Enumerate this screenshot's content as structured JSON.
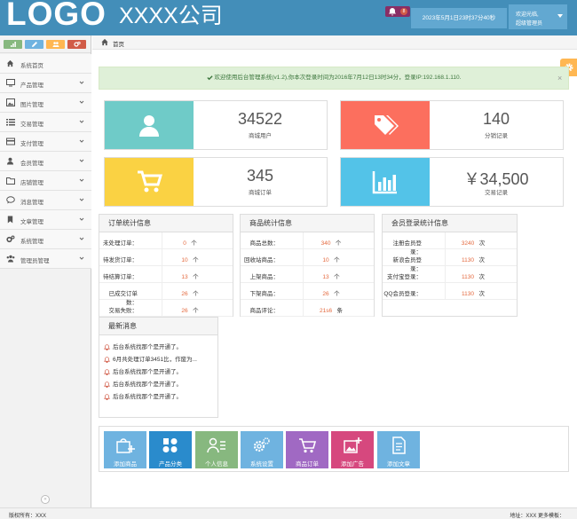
{
  "header": {
    "logo": "LOGO",
    "company": "XXXX公司",
    "notification_count": "8",
    "datetime": "2023年5月1日23时37分40秒",
    "welcome": "欢迎光临,",
    "username": "超级管理员",
    "bg_color": "#438eb9"
  },
  "sidebar": {
    "shortcuts": [
      {
        "icon": "signal-icon",
        "color": "#87b87f"
      },
      {
        "icon": "pencil-icon",
        "color": "#6fb3e0"
      },
      {
        "icon": "users-icon",
        "color": "#ffb752"
      },
      {
        "icon": "cogs-icon",
        "color": "#d15b47"
      }
    ],
    "items": [
      {
        "label": "系统首页",
        "icon": "home-icon"
      },
      {
        "label": "产品管理",
        "icon": "desktop-icon"
      },
      {
        "label": "图片管理",
        "icon": "picture-icon"
      },
      {
        "label": "交易管理",
        "icon": "list-icon"
      },
      {
        "label": "支付管理",
        "icon": "credit-card-icon"
      },
      {
        "label": "会员管理",
        "icon": "user-icon"
      },
      {
        "label": "店铺管理",
        "icon": "folder-icon"
      },
      {
        "label": "消息管理",
        "icon": "comments-icon"
      },
      {
        "label": "文章管理",
        "icon": "bookmark-icon"
      },
      {
        "label": "系统管理",
        "icon": "cogs-icon"
      },
      {
        "label": "管理员管理",
        "icon": "group-icon"
      }
    ],
    "collapse_glyph": "«"
  },
  "breadcrumb": {
    "home": "首页"
  },
  "welcome_message": "欢迎使用后台管理系统(v1.2),你本次登录时间为2016年7月12日13时34分，登录IP:192.168.1.110.",
  "welcome_close": "×",
  "stats": [
    {
      "value": "34522",
      "label": "商城用户",
      "icon": "user-icon",
      "color": "#6fcbc8"
    },
    {
      "value": "140",
      "label": "分销记录",
      "icon": "tags-icon",
      "color": "#fc6f5e"
    },
    {
      "value": "345",
      "label": "商城订单",
      "icon": "shopping-cart-icon",
      "color": "#fad243"
    },
    {
      "value": "￥34,500",
      "label": "交易记录",
      "icon": "bar-chart-icon",
      "color": "#53c3e8"
    }
  ],
  "order_panel": {
    "title": "订单统计信息",
    "unit": "个",
    "rows": [
      {
        "label": "未处理订单：",
        "value": "0"
      },
      {
        "label": "待发货订单：",
        "value": "10"
      },
      {
        "label": "待结算订单：",
        "value": "13"
      },
      {
        "label": "已成交订单数：",
        "value": "26"
      },
      {
        "label": "交易失败：",
        "value": "26"
      }
    ]
  },
  "product_panel": {
    "title": "商品统计信息",
    "rows": [
      {
        "label": "商品总数：",
        "value": "340",
        "unit": "个"
      },
      {
        "label": "回收站商品：",
        "value": "10",
        "unit": "个"
      },
      {
        "label": "上架商品：",
        "value": "13",
        "unit": "个"
      },
      {
        "label": "下架商品：",
        "value": "26",
        "unit": "个"
      },
      {
        "label": "商品评论：",
        "value": "21s6",
        "unit": "条"
      }
    ]
  },
  "member_panel": {
    "title": "会员登录统计信息",
    "unit": "次",
    "rows": [
      {
        "label": "注册会员登录：",
        "value": "3240"
      },
      {
        "label": "新浪会员登录：",
        "value": "1130"
      },
      {
        "label": "支付宝登录：",
        "value": "1130"
      },
      {
        "label": "QQ会员登录：",
        "value": "1130"
      }
    ]
  },
  "news": {
    "title": "最新消息",
    "items": [
      "后台系统找那个是开通了。",
      "6月共处理订单3451比，作废为...",
      "后台系统找那个是开通了。",
      "后台系统找那个是开通了。",
      "后台系统找那个是开通了。"
    ]
  },
  "quick_tiles": [
    {
      "label": "添加商品",
      "icon": "add-product-icon",
      "color": "#6fb3e0"
    },
    {
      "label": "产品分类",
      "icon": "category-icon",
      "color": "#2a8bcc"
    },
    {
      "label": "个人信息",
      "icon": "profile-icon",
      "color": "#87b87f"
    },
    {
      "label": "系统设置",
      "icon": "settings-icon",
      "color": "#6fb3e0"
    },
    {
      "label": "商品订单",
      "icon": "cart-icon",
      "color": "#a069c3"
    },
    {
      "label": "添加广告",
      "icon": "add-ad-icon",
      "color": "#d6487e"
    },
    {
      "label": "添加文章",
      "icon": "add-article-icon",
      "color": "#6fb3e0"
    }
  ],
  "footer": {
    "left": "版权所有：XXX",
    "right": "地址：XXX  更多模板："
  }
}
